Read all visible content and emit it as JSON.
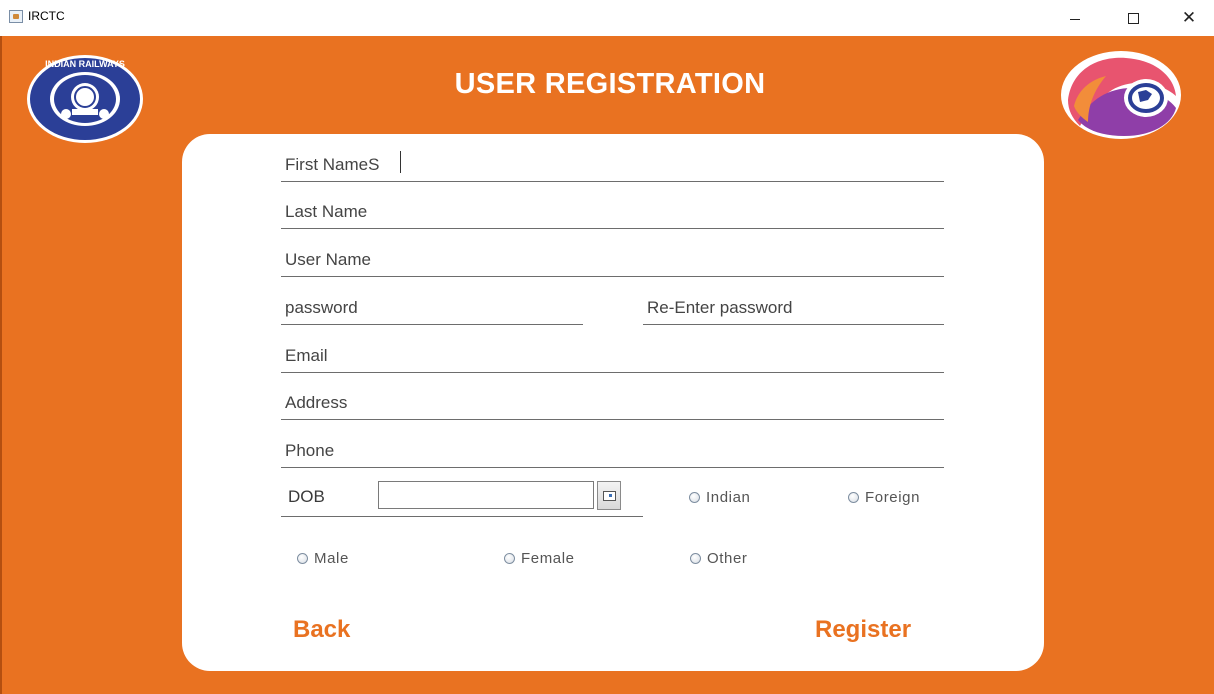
{
  "window": {
    "title": "IRCTC",
    "minimize_symbol": "",
    "maximize_symbol": "",
    "close_symbol": "✕"
  },
  "header": {
    "title": "USER REGISTRATION",
    "left_logo": "indian-railways-emblem",
    "left_logo_text": "INDIAN RAILWAYS",
    "right_logo": "irctc-logo"
  },
  "form": {
    "first_name": {
      "value": "",
      "placeholder": "First NameS"
    },
    "last_name": {
      "value": "",
      "placeholder": "Last Name"
    },
    "user_name": {
      "value": "",
      "placeholder": "User Name"
    },
    "password": {
      "value": "",
      "placeholder": "password"
    },
    "re_password": {
      "value": "",
      "placeholder": "Re-Enter password"
    },
    "email": {
      "value": "",
      "placeholder": "Email"
    },
    "address": {
      "value": "",
      "placeholder": "Address"
    },
    "phone": {
      "value": "",
      "placeholder": "Phone"
    },
    "dob": {
      "label": "DOB",
      "value": ""
    },
    "nationality": [
      {
        "label": "Indian"
      },
      {
        "label": "Foreign"
      }
    ],
    "gender": [
      {
        "label": "Male"
      },
      {
        "label": "Female"
      },
      {
        "label": "Other"
      }
    ]
  },
  "actions": {
    "back": "Back",
    "register": "Register"
  },
  "colors": {
    "accent": "#e97221",
    "card": "#ffffff",
    "text": "#3a3a3a"
  }
}
